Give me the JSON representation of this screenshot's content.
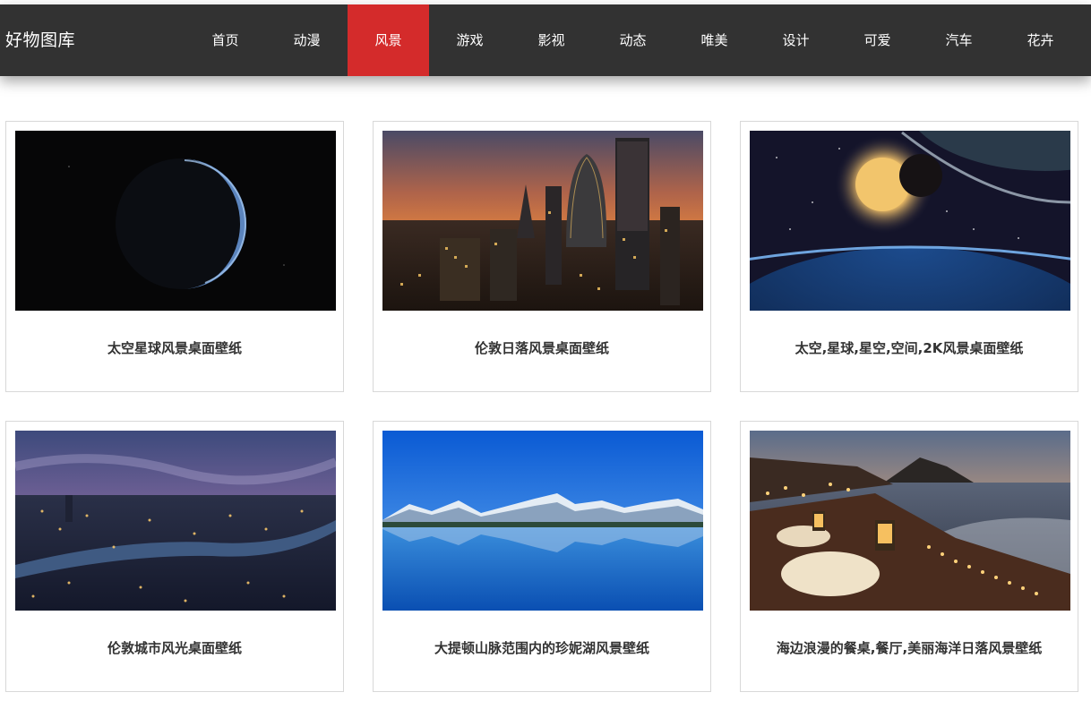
{
  "header": {
    "brand": "好物图库",
    "nav": [
      {
        "label": "首页",
        "active": false
      },
      {
        "label": "动漫",
        "active": false
      },
      {
        "label": "风景",
        "active": true
      },
      {
        "label": "游戏",
        "active": false
      },
      {
        "label": "影视",
        "active": false
      },
      {
        "label": "动态",
        "active": false
      },
      {
        "label": "唯美",
        "active": false
      },
      {
        "label": "设计",
        "active": false
      },
      {
        "label": "可爱",
        "active": false
      },
      {
        "label": "汽车",
        "active": false
      },
      {
        "label": "花卉",
        "active": false
      }
    ]
  },
  "colors": {
    "navbar": "#323232",
    "active": "#d42b2b",
    "card_border": "#d8d8d8",
    "caption_text": "#333333"
  },
  "gallery": {
    "items": [
      {
        "title": "太空星球风景桌面壁纸",
        "image": "planet-crescent-image"
      },
      {
        "title": "伦敦日落风景桌面壁纸",
        "image": "london-sunset-skyline-image"
      },
      {
        "title": "太空,星球,星空,空间,2K风景桌面壁纸",
        "image": "space-planets-sun-image"
      },
      {
        "title": "伦敦城市风光桌面壁纸",
        "image": "london-night-city-image"
      },
      {
        "title": "大提顿山脉范围内的珍妮湖风景壁纸",
        "image": "mountain-lake-image"
      },
      {
        "title": "海边浪漫的餐桌,餐厅,美丽海洋日落风景壁纸",
        "image": "seaside-dining-sunset-image"
      }
    ]
  }
}
